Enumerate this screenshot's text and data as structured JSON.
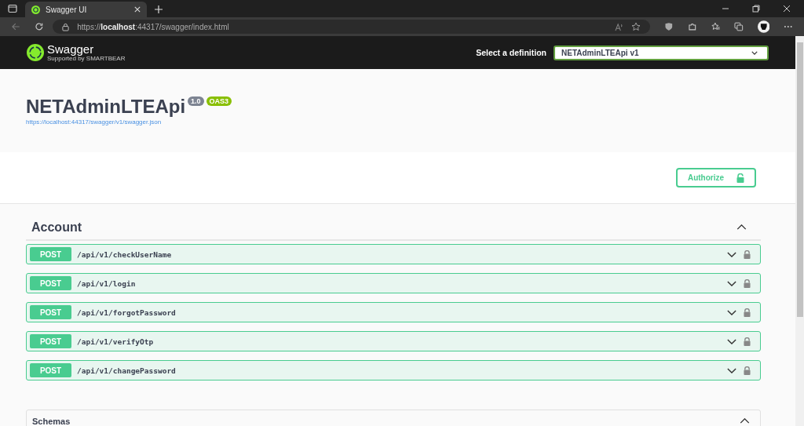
{
  "browser": {
    "tab": {
      "title": "Swagger UI"
    },
    "url": {
      "scheme": "https://",
      "host": "localhost",
      "rest": ":44317/swagger/index.html"
    }
  },
  "header": {
    "logo_text": "Swagger",
    "logo_subtext": "Supported by SMARTBEAR",
    "definition_label": "Select a definition",
    "definition_value": "NETAdminLTEApi v1"
  },
  "info": {
    "title": "NETAdminLTEApi",
    "version": "1.0",
    "spec": "OAS3",
    "spec_link": "https://localhost:44317/swagger/v1/swagger.json"
  },
  "authorize_button": "Authorize",
  "tags": [
    {
      "name": "Account",
      "expanded": true,
      "operations": [
        {
          "method": "POST",
          "path": "/api/v1/checkUserName"
        },
        {
          "method": "POST",
          "path": "/api/v1/login"
        },
        {
          "method": "POST",
          "path": "/api/v1/forgotPassword"
        },
        {
          "method": "POST",
          "path": "/api/v1/verifyOtp"
        },
        {
          "method": "POST",
          "path": "/api/v1/changePassword"
        }
      ]
    }
  ],
  "schemas": {
    "title": "Schemas",
    "expanded": true
  }
}
